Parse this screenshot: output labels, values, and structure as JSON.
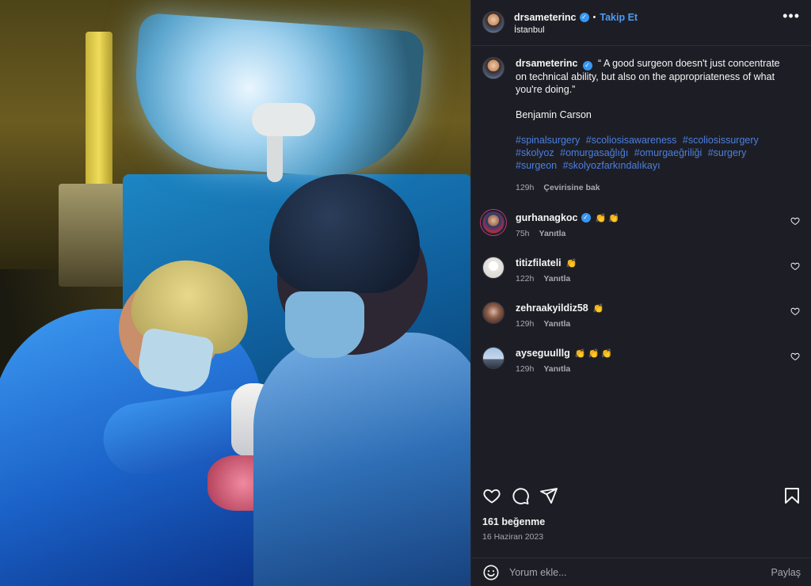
{
  "post": {
    "username": "drsameterinc",
    "follow_label": "Takip Et",
    "dot": "•",
    "location": "İstanbul",
    "more_label": "•••"
  },
  "caption": {
    "username": "drsameterinc",
    "quote": "“ A good surgeon doesn't just concentrate on technical ability, but also on the appropriateness of what you're doing.”",
    "author": "Benjamin Carson",
    "hashtags": [
      "#spinalsurgery",
      "#scoliosisawareness",
      "#scoliosissurgery",
      "#skolyoz",
      "#omurgasağlığı",
      "#omurgaeğriliği",
      "#surgery",
      "#surgeon",
      "#skolyozfarkındalıkayı"
    ],
    "time": "129h",
    "translate_label": "Çevirisine bak"
  },
  "comments": [
    {
      "username": "gurhanagkoc",
      "verified": true,
      "emoji": "👏 👏",
      "time": "75h",
      "reply_label": "Yanıtla"
    },
    {
      "username": "titizfilateli",
      "verified": false,
      "emoji": "👏",
      "time": "122h",
      "reply_label": "Yanıtla"
    },
    {
      "username": "zehraakyildiz58",
      "verified": false,
      "emoji": "👏",
      "time": "129h",
      "reply_label": "Yanıtla"
    },
    {
      "username": "ayseguulllg",
      "verified": false,
      "emoji": "👏 👏 👏",
      "time": "129h",
      "reply_label": "Yanıtla"
    }
  ],
  "actions": {
    "likes": "161 beğenme",
    "date": "16 Haziran 2023"
  },
  "add_comment": {
    "placeholder": "Yorum ekle...",
    "share_label": "Paylaş"
  },
  "icons": [
    "verified-badge-icon",
    "more-icon",
    "heart-icon",
    "comment-icon",
    "share-icon",
    "bookmark-icon",
    "emoji-icon"
  ],
  "colors": {
    "panel_bg": "#1d1e25",
    "link_blue": "#4c9bf5",
    "hashtag_blue": "#4c7fe0",
    "muted": "#a7a8b0"
  }
}
